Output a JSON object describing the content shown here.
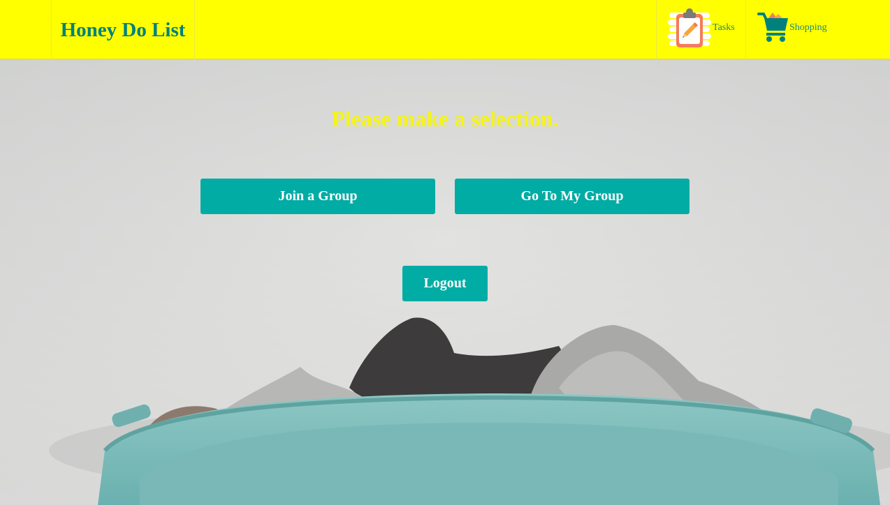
{
  "navbar": {
    "brand": "Honey Do List",
    "links": [
      {
        "label": "Tasks",
        "icon": "clipboard-pencil-icon"
      },
      {
        "label": "Shopping",
        "icon": "shopping-cart-icon"
      }
    ]
  },
  "main": {
    "prompt": "Please make a selection.",
    "join_label": "Join a Group",
    "go_group_label": "Go To My Group",
    "logout_label": "Logout"
  },
  "colors": {
    "navbar_bg": "#ffff00",
    "brand_text": "#00817e",
    "button_bg": "#00aca4",
    "prompt_text": "#f6f416"
  }
}
